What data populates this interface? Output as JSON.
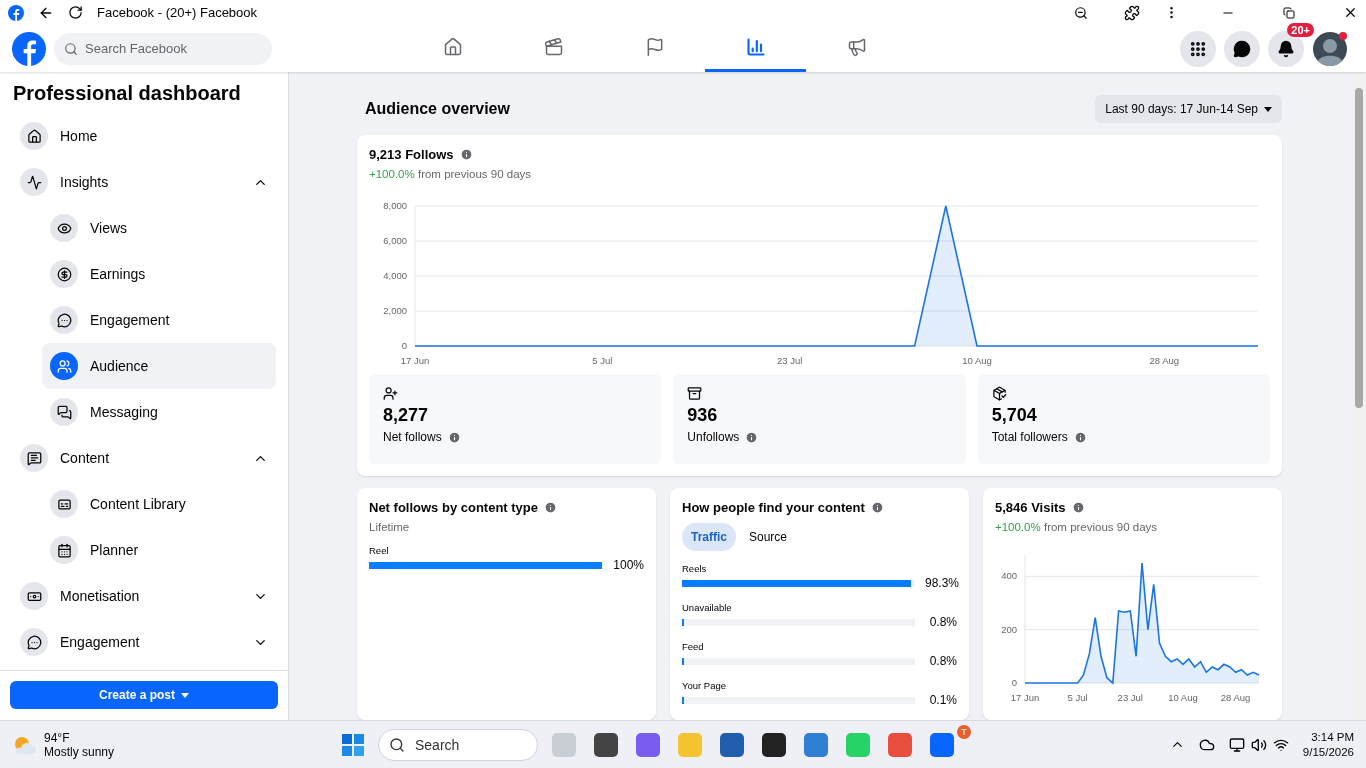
{
  "browser": {
    "title": "Facebook - (20+) Facebook"
  },
  "header": {
    "search_placeholder": "Search Facebook",
    "nav_tabs": [
      {
        "selected": false
      },
      {
        "selected": false
      },
      {
        "selected": false
      },
      {
        "selected": true
      },
      {
        "selected": false
      }
    ],
    "notification_badge": "20+"
  },
  "sidebar": {
    "title": "Professional dashboard",
    "items": [
      {
        "label": "Home",
        "selected": false
      },
      {
        "label": "Insights",
        "selected": false,
        "expanded": true,
        "children": [
          {
            "label": "Views",
            "selected": false
          },
          {
            "label": "Earnings",
            "selected": false
          },
          {
            "label": "Engagement",
            "selected": false
          },
          {
            "label": "Audience",
            "selected": true
          },
          {
            "label": "Messaging",
            "selected": false
          }
        ]
      },
      {
        "label": "Content",
        "selected": false,
        "expanded": true,
        "children": [
          {
            "label": "Content Library",
            "selected": false
          },
          {
            "label": "Planner",
            "selected": false
          }
        ]
      },
      {
        "label": "Monetisation",
        "selected": false,
        "expanded": false
      },
      {
        "label": "Engagement",
        "selected": false,
        "expanded": false
      }
    ],
    "create_button": "Create a post"
  },
  "main": {
    "title": "Audience overview",
    "date_range": "Last 90 days: 17 Jun-14 Sep",
    "follows": {
      "title": "9,213 Follows",
      "change": "+100.0%",
      "change_text": "from previous 90 days",
      "chart_data": {
        "type": "area",
        "categories": [
          "17 Jun",
          null,
          null,
          null,
          null,
          null,
          "5 Jul",
          null,
          null,
          null,
          null,
          null,
          "23 Jul",
          null,
          null,
          null,
          null,
          null,
          "10 Aug",
          null,
          null,
          null,
          null,
          null,
          "28 Aug",
          null,
          null,
          null
        ],
        "series": [
          {
            "color": "#1b74e4",
            "values": [
              0,
              0,
              0,
              0,
              0,
              0,
              0,
              0,
              0,
              0,
              0,
              0,
              0,
              0,
              0,
              0,
              0,
              8000,
              0,
              0,
              0,
              0,
              0,
              0,
              0,
              0,
              0,
              0
            ]
          }
        ],
        "ylim": [
          0,
          8000
        ],
        "grid": true,
        "yticks": [
          {
            "value": 0,
            "label": "0"
          },
          {
            "value": 2000,
            "label": "2,000"
          },
          {
            "value": 4000,
            "label": "4,000"
          },
          {
            "value": 6000,
            "label": "6,000"
          },
          {
            "value": 8000,
            "label": "8,000"
          }
        ]
      },
      "stats": [
        {
          "value": "8,277",
          "label": "Net follows"
        },
        {
          "value": "936",
          "label": "Unfollows"
        },
        {
          "value": "5,704",
          "label": "Total followers"
        }
      ]
    },
    "content_type": {
      "title": "Net follows by content type",
      "subtitle": "Lifetime",
      "rows": [
        {
          "label": "Reel",
          "level": 1,
          "reading": "100%"
        }
      ]
    },
    "discovery": {
      "title": "How people find your content",
      "tabs": [
        {
          "label": "Traffic",
          "selected": true
        },
        {
          "label": "Source",
          "selected": false
        }
      ],
      "rows": [
        {
          "label": "Reels",
          "level": 0.983,
          "reading": "98.3%"
        },
        {
          "label": "Unavailable",
          "level": 0.008,
          "reading": "0.8%"
        },
        {
          "label": "Feed",
          "level": 0.008,
          "reading": "0.8%"
        },
        {
          "label": "Your Page",
          "level": 0.001,
          "reading": "0.1%"
        }
      ]
    },
    "visits": {
      "title": "5,846 Visits",
      "change": "+100.0%",
      "change_text": "from previous 90 days",
      "chart_data": {
        "type": "area",
        "categories": [
          "17 Jun",
          null,
          null,
          null,
          null,
          null,
          null,
          null,
          null,
          "5 Jul",
          null,
          null,
          null,
          null,
          null,
          null,
          null,
          null,
          "23 Jul",
          null,
          null,
          null,
          null,
          null,
          null,
          null,
          null,
          "10 Aug",
          null,
          null,
          null,
          null,
          null,
          null,
          null,
          null,
          "28 Aug",
          null,
          null,
          null,
          null
        ],
        "series": [
          {
            "color": "#1b74e4",
            "values": [
              0,
              0,
              0,
              0,
              0,
              0,
              0,
              0,
              0,
              0,
              30,
              110,
              245,
              100,
              20,
              0,
              270,
              265,
              270,
              100,
              450,
              200,
              370,
              150,
              100,
              80,
              90,
              70,
              90,
              60,
              80,
              40,
              60,
              50,
              70,
              60,
              40,
              50,
              30,
              40,
              30
            ]
          }
        ],
        "ylim": [
          0,
          480
        ],
        "grid": true,
        "yticks": [
          {
            "value": 0,
            "label": "0"
          },
          {
            "value": 200,
            "label": "200"
          },
          {
            "value": 400,
            "label": "400"
          }
        ]
      }
    }
  },
  "taskbar": {
    "temperature": "94°F",
    "weather": "Mostly sunny",
    "search_placeholder": "Search",
    "app_badge": "T",
    "time": "3:14 PM",
    "date": "9/15/2026"
  }
}
